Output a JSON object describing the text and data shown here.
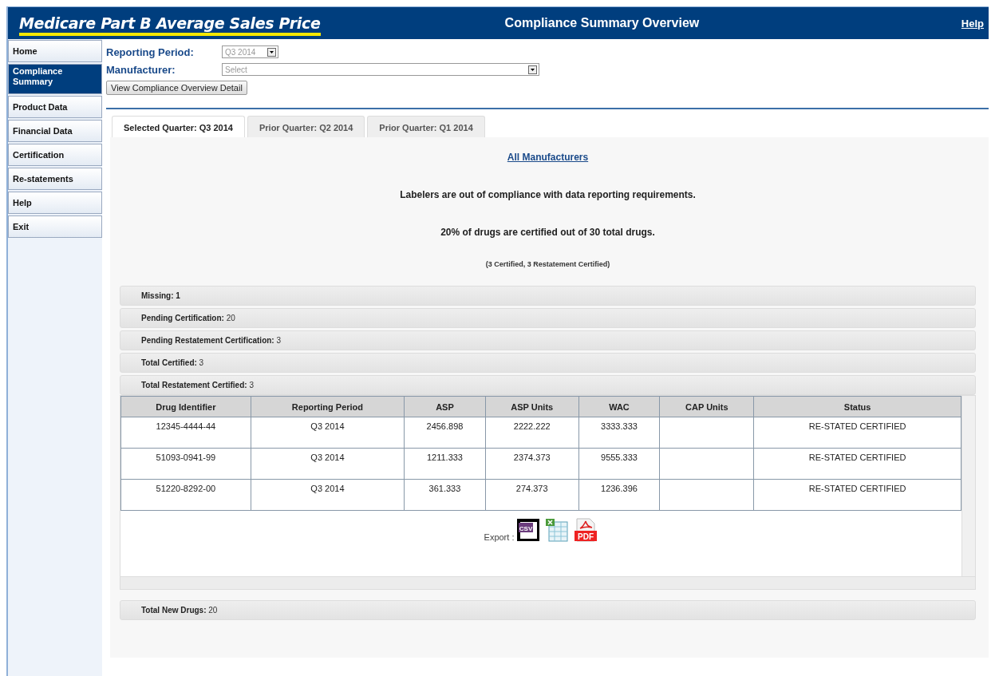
{
  "header": {
    "logo": "Medicare Part B Average Sales Price",
    "title": "Compliance Summary Overview",
    "help_link": "Help"
  },
  "sidebar": {
    "items": [
      {
        "label": "Home",
        "selected": false
      },
      {
        "label": "Compliance Summary",
        "selected": true
      },
      {
        "label": "Product Data",
        "selected": false
      },
      {
        "label": "Financial Data",
        "selected": false
      },
      {
        "label": "Certification",
        "selected": false
      },
      {
        "label": "Re-statements",
        "selected": false
      },
      {
        "label": "Help",
        "selected": false
      },
      {
        "label": "Exit",
        "selected": false
      }
    ]
  },
  "filters": {
    "reporting_period": {
      "label": "Reporting Period:",
      "value": "Q3 2014"
    },
    "manufacturer": {
      "label": "Manufacturer:",
      "placeholder": "Select"
    },
    "button": "View Compliance Overview Detail"
  },
  "tabs": [
    {
      "label": "Selected Quarter: Q3 2014",
      "selected": true
    },
    {
      "label": "Prior Quarter: Q2 2014",
      "selected": false
    },
    {
      "label": "Prior Quarter: Q1 2014",
      "selected": false
    }
  ],
  "summary": {
    "link": "All Manufacturers",
    "message": "Labelers are out of compliance with data reporting requirements.",
    "certified_line": "20% of drugs are certified out of 30 total drugs.",
    "breakdown": "(3 Certified, 3 Restatement Certified)"
  },
  "sections": [
    {
      "label": "**Missing: 1**",
      "expanded": false
    },
    {
      "label": "**Pending Certification:** 20",
      "expanded": false
    },
    {
      "label": "**Pending Restatement Certification:** 3",
      "expanded": false
    },
    {
      "label": "**Total Certified:** 3",
      "expanded": false
    },
    {
      "label": "**Total Restatement Certified:** 3",
      "expanded": true
    }
  ],
  "table": {
    "columns": [
      "Drug Identifier",
      "Reporting Period",
      "ASP",
      "ASP Units",
      "WAC",
      "CAP Units",
      "Status"
    ],
    "rows": [
      [
        "12345-4444-44",
        "Q3 2014",
        "2456.898",
        "2222.222",
        "3333.333",
        "",
        "RE-STATED CERTIFIED"
      ],
      [
        "51093-0941-99",
        "Q3 2014",
        "1211.333",
        "2374.373",
        "9555.333",
        "",
        "RE-STATED CERTIFIED"
      ],
      [
        "51220-8292-00",
        "Q3 2014",
        "361.333",
        "274.373",
        "1236.396",
        "",
        "RE-STATED CERTIFIED"
      ]
    ]
  },
  "export": {
    "label": "Export :",
    "formats": [
      {
        "kind": "csv",
        "text": "CSV"
      },
      {
        "kind": "xls"
      },
      {
        "kind": "pdf",
        "text": "PDF"
      }
    ]
  },
  "footer_section": {
    "label": "**Total New Drugs:** 20",
    "expanded": false
  }
}
